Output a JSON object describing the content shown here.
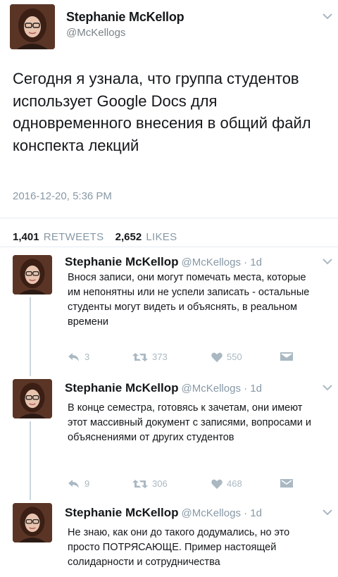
{
  "main_tweet": {
    "name": "Stephanie McKellop",
    "handle": "@McKellogs",
    "text": "Сегодня я узнала, что группа студентов использует Google Docs для одновременного внесения в общий файл конспекта лекций",
    "timestamp": "2016-12-20, 5:36 PM",
    "retweets_count": "1,401",
    "retweets_label": "RETWEETS",
    "likes_count": "2,652",
    "likes_label": "LIKES"
  },
  "replies": [
    {
      "name": "Stephanie McKellop",
      "handle_time": "@McKellogs · 1d",
      "text": "Внося записи, они могут помечать места, которые им непонятны или не успели записать - остальные студенты могут видеть и объяснять, в реальном времени",
      "replies": "3",
      "retweets": "373",
      "likes": "550"
    },
    {
      "name": "Stephanie McKellop",
      "handle_time": "@McKellogs · 1d",
      "text": "В конце семестра, готовясь к зачетам, они имеют этот массивный документ с записями, вопросами и объяснениями от других студентов",
      "replies": "9",
      "retweets": "306",
      "likes": "468"
    },
    {
      "name": "Stephanie McKellop",
      "handle_time": "@McKellogs · 1d",
      "text": "Не знаю, как они до такого додумались, но это просто ПОТРЯСАЮЩЕ. Пример настоящей солидарности и сотрудничества"
    }
  ],
  "icons": {
    "reply": "reply-icon",
    "retweet": "retweet-icon",
    "like": "heart-icon",
    "message": "direct-message-icon",
    "menu": "chevron-down-icon"
  },
  "colors": {
    "text": "#14171a",
    "muted": "#8899a6",
    "icon": "#aab8c2",
    "thread_line": "#ccd6dd"
  }
}
